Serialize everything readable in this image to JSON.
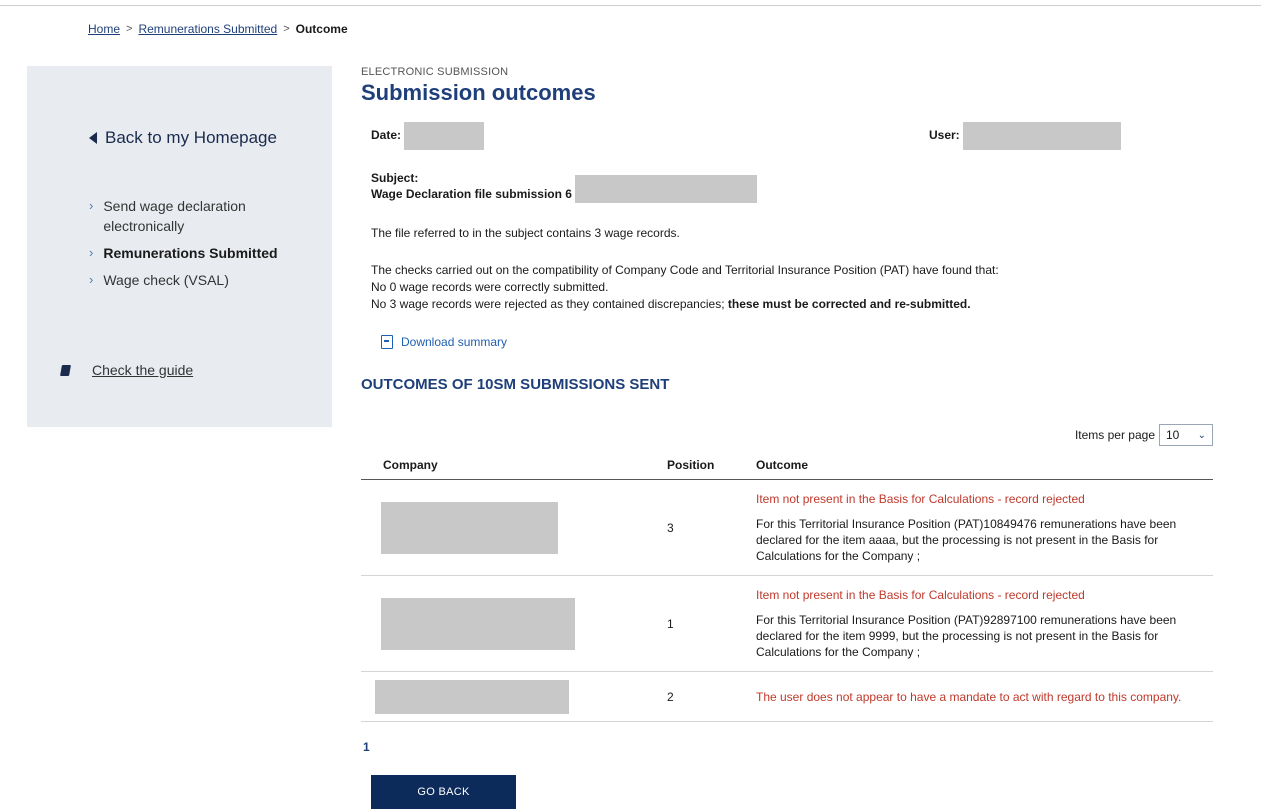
{
  "breadcrumb": {
    "home": "Home",
    "remunerations": "Remunerations Submitted",
    "current": "Outcome"
  },
  "sidebar": {
    "back_home": "Back to my Homepage",
    "items": [
      {
        "label": "Send wage declaration electronically"
      },
      {
        "label": "Remunerations Submitted"
      },
      {
        "label": "Wage check (VSAL)"
      }
    ],
    "guide": "Check the guide"
  },
  "main": {
    "kicker": "ELECTRONIC SUBMISSION",
    "title": "Submission outcomes",
    "date_label": "Date:",
    "user_label": "User:",
    "subject_label": "Subject:",
    "subject_value": "Wage Declaration file submission 6",
    "file_info": "The file referred to in the subject contains 3 wage records.",
    "checks_line": "The checks carried out on the compatibility of Company Code and Territorial Insurance Position (PAT) have found that:",
    "ok_line": "No 0 wage records were correctly submitted.",
    "rejected_line": "No 3 wage records were rejected as they contained discrepancies;",
    "rejected_bold": " these must be corrected and re-submitted.",
    "download": "Download summary",
    "section_title": "OUTCOMES OF 10SM SUBMISSIONS SENT",
    "items_per_page_label": "Items per page",
    "items_per_page_value": "10"
  },
  "table": {
    "headers": {
      "company": "Company",
      "position": "Position",
      "outcome": "Outcome"
    },
    "rows": [
      {
        "position": "3",
        "outcome_red": "Item not present in the Basis for Calculations - record rejected",
        "outcome_text": "For this Territorial Insurance Position (PAT)10849476 remunerations have been declared for the item aaaa, but the processing is not present in the Basis for Calculations for the Company ;"
      },
      {
        "position": "1",
        "outcome_red": "Item not present in the Basis for Calculations - record rejected",
        "outcome_text": "For this Territorial Insurance Position (PAT)92897100 remunerations have been declared for the item 9999, but the processing is not present in the Basis for Calculations for the Company ;"
      },
      {
        "position": "2",
        "outcome_red": "The user does not appear to have a mandate to act with regard to this company.",
        "outcome_text": ""
      }
    ]
  },
  "pager": {
    "current": "1"
  },
  "actions": {
    "go_back": "GO BACK"
  }
}
